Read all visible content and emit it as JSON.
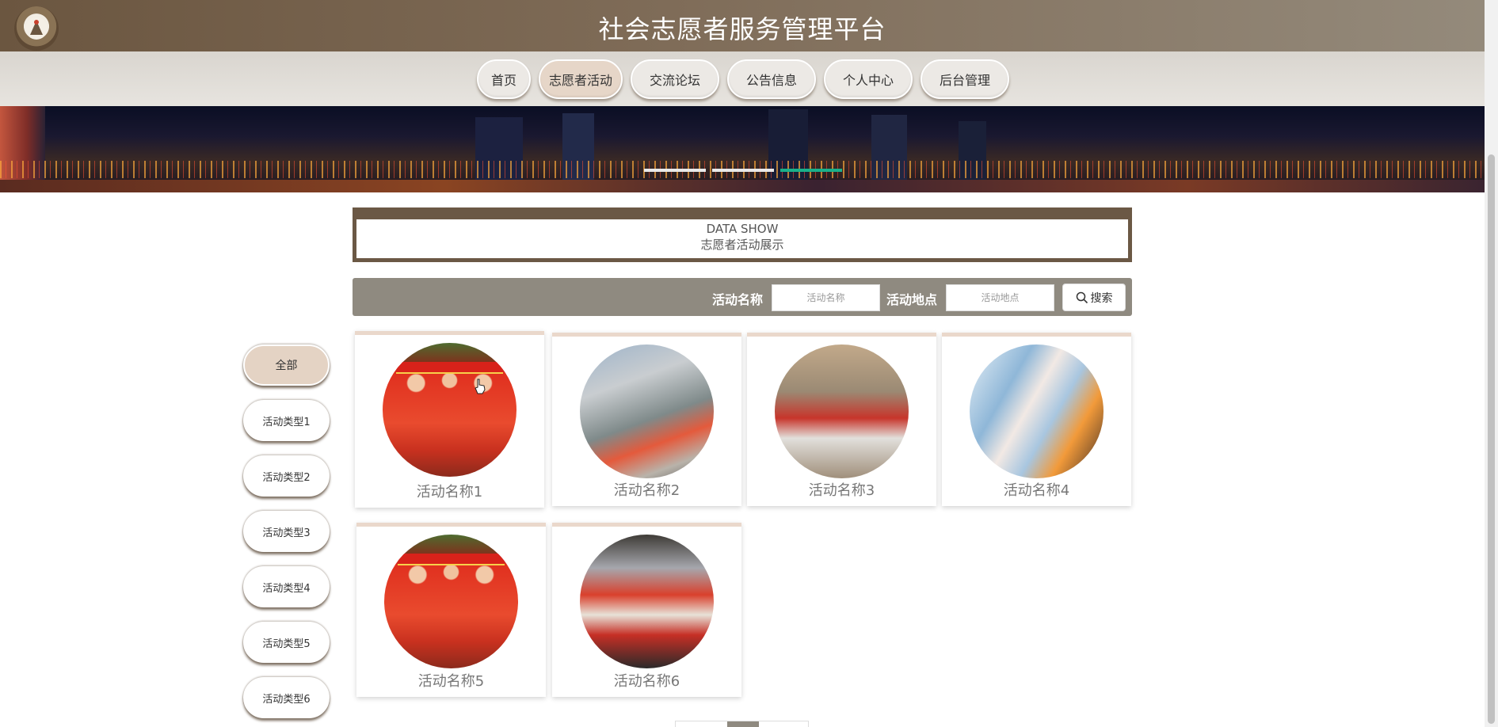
{
  "header": {
    "title": "社会志愿者服务管理平台",
    "logo_icon": "volunteer-logo-icon"
  },
  "nav": {
    "items": [
      {
        "label": "首页",
        "active": false
      },
      {
        "label": "志愿者活动",
        "active": true
      },
      {
        "label": "交流论坛",
        "active": false
      },
      {
        "label": "公告信息",
        "active": false
      },
      {
        "label": "个人中心",
        "active": false
      },
      {
        "label": "后台管理",
        "active": false
      }
    ]
  },
  "banner": {
    "slides": 3,
    "active_slide": 3
  },
  "section": {
    "title_en": "DATA SHOW",
    "title_cn": "志愿者活动展示"
  },
  "search": {
    "name_label": "活动名称",
    "name_placeholder": "活动名称",
    "place_label": "活动地点",
    "place_placeholder": "活动地点",
    "button_label": "搜索",
    "button_icon": "search-icon"
  },
  "categories": [
    {
      "label": "全部",
      "active": true
    },
    {
      "label": "活动类型1",
      "active": false
    },
    {
      "label": "活动类型2",
      "active": false
    },
    {
      "label": "活动类型3",
      "active": false
    },
    {
      "label": "活动类型4",
      "active": false
    },
    {
      "label": "活动类型5",
      "active": false
    },
    {
      "label": "活动类型6",
      "active": false
    }
  ],
  "activities": [
    {
      "name": "活动名称1"
    },
    {
      "name": "活动名称2"
    },
    {
      "name": "活动名称3"
    },
    {
      "name": "活动名称4"
    },
    {
      "name": "活动名称5"
    },
    {
      "name": "活动名称6"
    }
  ],
  "colors": {
    "header_brown": "#6b5640",
    "accent_beige": "#e6d6c8",
    "search_gray": "#8f8a80",
    "active_dot": "#1ab08a"
  }
}
